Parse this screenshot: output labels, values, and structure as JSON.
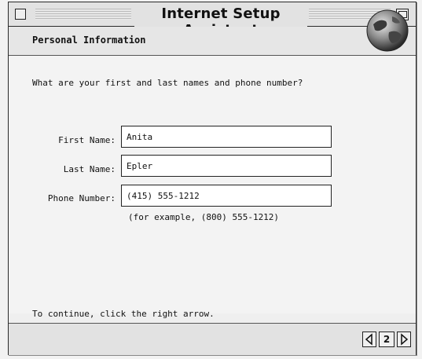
{
  "window": {
    "title": "Internet Setup Assistant"
  },
  "header": {
    "title": "Personal Information",
    "icon": "globe-icon"
  },
  "main": {
    "question": "What are your first and last names and phone number?",
    "fields": [
      {
        "label": "First Name:",
        "value": "Anita"
      },
      {
        "label": "Last Name:",
        "value": "Epler"
      },
      {
        "label": "Phone Number:",
        "value": "(415) 555-1212"
      }
    ],
    "example": "(for example, (800) 555-1212)",
    "continue_hint": "To continue, click the right arrow."
  },
  "footer": {
    "page_number": "2",
    "prev_icon": "left-arrow-icon",
    "next_icon": "right-arrow-icon"
  }
}
